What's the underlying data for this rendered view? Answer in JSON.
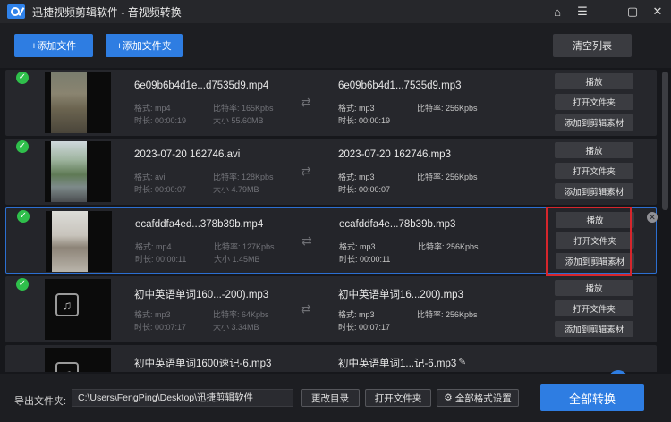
{
  "window": {
    "app_name": "迅捷视频剪辑软件",
    "separator": " - ",
    "page_name": "音视频转换",
    "icons": [
      "home-icon",
      "menu-icon",
      "minimize-icon",
      "maximize-icon",
      "close-icon"
    ]
  },
  "toolbar": {
    "add_file": "+添加文件",
    "add_folder": "+添加文件夹",
    "clear_list": "清空列表"
  },
  "labels": {
    "format": "格式: ",
    "bitrate": "比特率: ",
    "duration": "时长: ",
    "size": "大小 "
  },
  "actions": {
    "play": "播放",
    "open_folder": "打开文件夹",
    "add_to_material": "添加到剪辑素材"
  },
  "files": [
    {
      "src_name": "6e09b6b4d1e...d7535d9.mp4",
      "src_format": "格式: mp4",
      "src_bitrate": "比特率: 165Kpbs",
      "src_duration": "时长: 00:00:19",
      "src_size": "大小 55.60MB",
      "dst_name": "6e09b6b4d1...7535d9.mp3",
      "dst_format": "格式: mp3",
      "dst_bitrate": "比特率: 256Kpbs",
      "dst_duration": "时长: 00:00:19",
      "thumb": "video"
    },
    {
      "src_name": "2023-07-20 162746.avi",
      "src_format": "格式: avi",
      "src_bitrate": "比特率: 128Kpbs",
      "src_duration": "时长: 00:00:07",
      "src_size": "大小 4.79MB",
      "dst_name": "2023-07-20 162746.mp3",
      "dst_format": "格式: mp3",
      "dst_bitrate": "比特率: 256Kpbs",
      "dst_duration": "时长: 00:00:07",
      "thumb": "video"
    },
    {
      "src_name": "ecafddfa4ed...378b39b.mp4",
      "src_format": "格式: mp4",
      "src_bitrate": "比特率: 127Kpbs",
      "src_duration": "时长: 00:00:11",
      "src_size": "大小 1.45MB",
      "dst_name": "ecafddfa4e...78b39b.mp3",
      "dst_format": "格式: mp3",
      "dst_bitrate": "比特率: 256Kpbs",
      "dst_duration": "时长: 00:00:11",
      "thumb": "video"
    },
    {
      "src_name": "初中英语单词160...-200).mp3",
      "src_format": "格式: mp3",
      "src_bitrate": "比特率: 64Kpbs",
      "src_duration": "时长: 00:07:17",
      "src_size": "大小 3.34MB",
      "dst_name": "初中英语单词16...200).mp3",
      "dst_format": "格式: mp3",
      "dst_bitrate": "比特率: 256Kpbs",
      "dst_duration": "时长: 00:07:17",
      "thumb": "music"
    },
    {
      "src_name": "初中英语单词1600速记-6.mp3",
      "dst_name": "初中英语单词1...记-6.mp3",
      "thumb": "music"
    }
  ],
  "bottom": {
    "output_label": "导出文件夹:",
    "output_path": "C:\\Users\\FengPing\\Desktop\\迅捷剪辑软件",
    "change_dir": "更改目录",
    "open_folder": "打开文件夹",
    "format_settings": "全部格式设置",
    "convert_all": "全部转换"
  },
  "colors": {
    "accent": "#2e7de2",
    "check": "#2fbf4b",
    "highlight": "#d6262c"
  }
}
